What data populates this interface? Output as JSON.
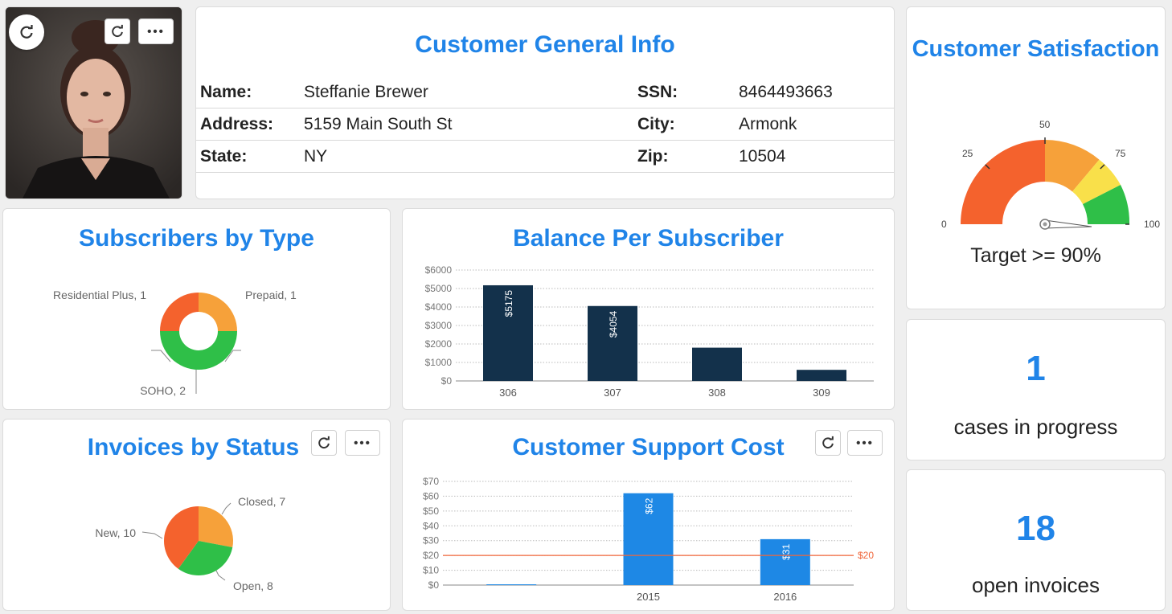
{
  "photo": {
    "alt": "Customer photo"
  },
  "general_info": {
    "title": "Customer General Info",
    "rows": [
      {
        "l1": "Name:",
        "v1": "Steffanie Brewer",
        "l2": "SSN:",
        "v2": "8464493663"
      },
      {
        "l1": "Address:",
        "v1": "5159 Main South St",
        "l2": "City:",
        "v2": "Armonk"
      },
      {
        "l1": "State:",
        "v1": "NY",
        "l2": "Zip:",
        "v2": "10504"
      }
    ]
  },
  "satisfaction": {
    "title": "Customer Satisfaction",
    "ticks": [
      "0",
      "25",
      "50",
      "75",
      "100"
    ],
    "target_text": "Target >= 90%",
    "colors": [
      "#f4622d",
      "#f6a13a",
      "#f9e04a",
      "#2fbf48"
    ]
  },
  "cases": {
    "value": "1",
    "caption": "cases in progress"
  },
  "invoices_open": {
    "value": "18",
    "caption": "open invoices"
  },
  "subscribers": {
    "title": "Subscribers by Type",
    "labels": {
      "residential": "Residential Plus, 1",
      "prepaid": "Prepaid, 1",
      "soho": "SOHO, 2"
    }
  },
  "invoices_status": {
    "title": "Invoices by Status",
    "labels": {
      "new": "New, 10",
      "closed": "Closed, 7",
      "open": "Open, 8"
    }
  },
  "balance": {
    "title": "Balance Per Subscriber",
    "yticks": [
      "$6000",
      "$5000",
      "$4000",
      "$3000",
      "$2000",
      "$1000",
      "$0"
    ],
    "bar_labels": [
      "$5175",
      "$4054",
      "",
      ""
    ]
  },
  "support": {
    "title": "Customer Support Cost",
    "yticks": [
      "$70",
      "$60",
      "$50",
      "$40",
      "$30",
      "$20",
      "$10",
      "$0"
    ],
    "bar_labels": [
      "",
      "$62",
      "$31"
    ],
    "threshold_label": "$20"
  },
  "chart_data": [
    {
      "type": "pie",
      "title": "Subscribers by Type",
      "categories": [
        "Residential Plus",
        "Prepaid",
        "SOHO"
      ],
      "values": [
        1,
        1,
        2
      ],
      "colors": [
        "#f4622d",
        "#f6a13a",
        "#2fbf48"
      ],
      "donut": true
    },
    {
      "type": "bar",
      "title": "Balance Per Subscriber",
      "categories": [
        "306",
        "307",
        "308",
        "309"
      ],
      "values": [
        5175,
        4054,
        1800,
        600
      ],
      "ylim": [
        0,
        6000
      ],
      "color": "#13314b"
    },
    {
      "type": "pie",
      "title": "Invoices by Status",
      "categories": [
        "Closed",
        "Open",
        "New"
      ],
      "values": [
        7,
        8,
        10
      ],
      "colors": [
        "#f6a13a",
        "#2fbf48",
        "#f4622d"
      ]
    },
    {
      "type": "bar",
      "title": "Customer Support Cost",
      "categories": [
        "",
        "2015",
        "2016"
      ],
      "values": [
        0.5,
        62,
        31
      ],
      "ylim": [
        0,
        70
      ],
      "threshold": 20,
      "color": "#1e88e5",
      "threshold_color": "#f0663a"
    }
  ]
}
